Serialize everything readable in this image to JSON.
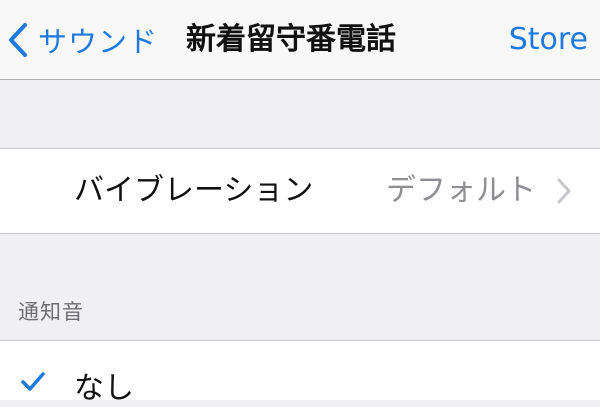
{
  "nav": {
    "back_label": "サウンド",
    "title": "新着留守番電話",
    "store_label": "Store"
  },
  "vibration": {
    "label": "バイブレーション",
    "value": "デフォルト"
  },
  "tones": {
    "section_header": "通知音",
    "items": [
      {
        "label": "なし",
        "selected": true
      }
    ]
  },
  "icons": {
    "back": "chevron-left-icon",
    "disclosure": "chevron-right-icon",
    "selected": "checkmark-icon"
  },
  "colors": {
    "accent": "#1f7ae0",
    "background": "#efeff4",
    "cell": "#ffffff",
    "secondary_text": "#8e8e93"
  }
}
